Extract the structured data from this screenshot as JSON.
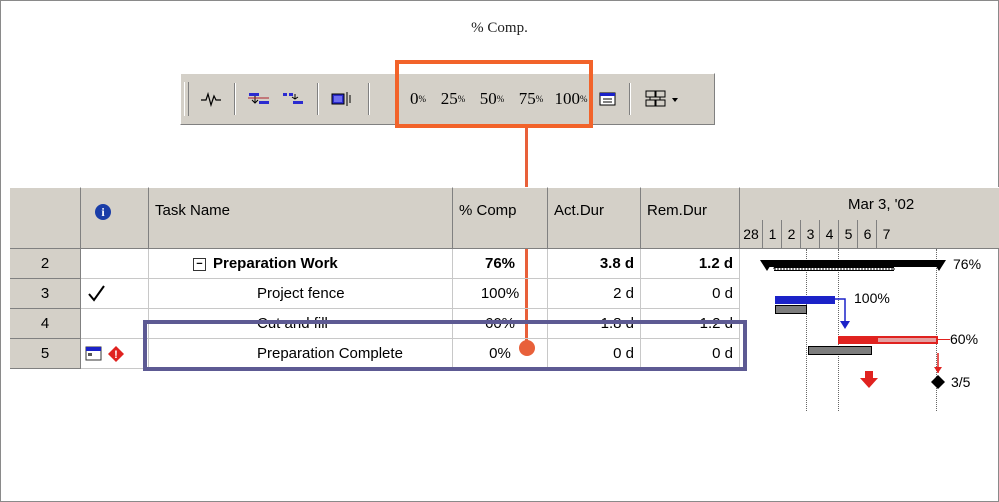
{
  "caption": "% Comp.",
  "toolbar": {
    "buttons": [
      {
        "name": "split-task",
        "icon": "split-task-icon"
      },
      {
        "name": "link-tasks",
        "icon": "link-icon"
      },
      {
        "name": "unlink-tasks",
        "icon": "unlink-icon"
      },
      {
        "name": "task-notes",
        "icon": "notes-icon"
      },
      {
        "name": "complete-0",
        "label": "0",
        "icon": "pct-icon"
      },
      {
        "name": "complete-25",
        "label": "25",
        "icon": "pct-icon"
      },
      {
        "name": "complete-50",
        "label": "50",
        "icon": "pct-icon"
      },
      {
        "name": "complete-75",
        "label": "75",
        "icon": "pct-icon"
      },
      {
        "name": "complete-100",
        "label": "100",
        "icon": "pct-icon"
      },
      {
        "name": "update-as-scheduled",
        "icon": "calendar-icon"
      },
      {
        "name": "reschedule",
        "icon": "reschedule-icon"
      }
    ],
    "highlight_color": "#f2632a"
  },
  "table": {
    "columns": [
      "",
      "i",
      "Task Name",
      "% Comp",
      "Act.Dur",
      "Rem.Dur"
    ],
    "rows": [
      {
        "id": "2",
        "indicator": "",
        "name": "Preparation Work",
        "pct": "76%",
        "act": "3.8 d",
        "rem": "1.2 d",
        "summary": true
      },
      {
        "id": "3",
        "indicator": "check-icon",
        "name": "Project fence",
        "pct": "100%",
        "act": "2 d",
        "rem": "0 d",
        "summary": false
      },
      {
        "id": "4",
        "indicator": "",
        "name": "Cut and fill",
        "pct": "60%",
        "act": "1.8 d",
        "rem": "1.2 d",
        "summary": false
      },
      {
        "id": "5",
        "indicator": "calendar-constraint-icon,alert-icon",
        "name": "Preparation Complete",
        "pct": "0%",
        "act": "0 d",
        "rem": "0 d",
        "summary": false
      }
    ],
    "highlight_color": "#5d5a93"
  },
  "gantt": {
    "week_label": "Mar 3, '02",
    "days": [
      "28",
      "1",
      "2",
      "3",
      "4",
      "5",
      "6",
      "7"
    ],
    "bar_labels": [
      "76%",
      "100%",
      "60%",
      "3/5"
    ],
    "colors": {
      "summary": "#000000",
      "progress_blue": "#1b22c8",
      "progress_red": "#e0221f",
      "baseline": "#7d7d7d",
      "milestone_red": "#e0221f"
    }
  }
}
